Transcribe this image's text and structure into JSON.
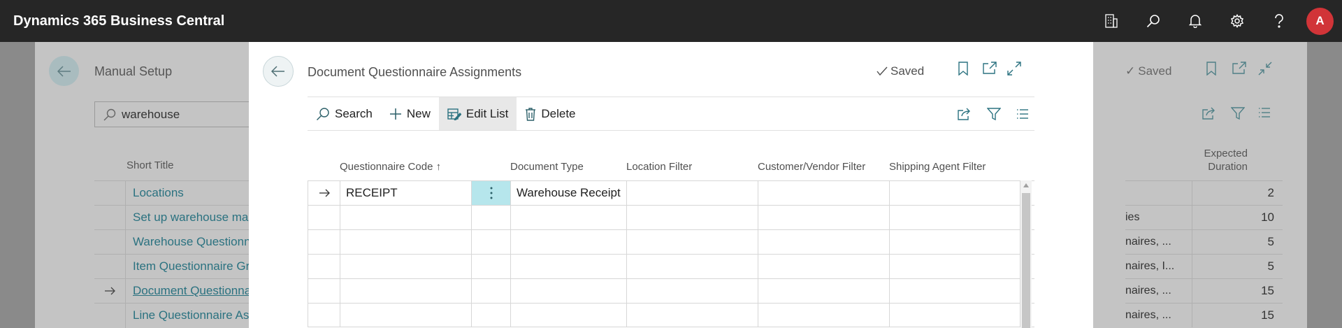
{
  "app": {
    "title": "Dynamics 365 Business Central",
    "avatar_initial": "A"
  },
  "appbar_icons": [
    "company-icon",
    "search-icon",
    "bell-icon",
    "gear-icon",
    "help-icon"
  ],
  "background": {
    "title": "Manual Setup",
    "search_value": "warehouse",
    "saved_label": "Saved",
    "column_short_title": "Short Title",
    "column_expected_line1": "Expected",
    "column_expected_line2": "Duration",
    "rows": [
      {
        "title": "Locations",
        "extra": "",
        "duration": "2"
      },
      {
        "title": "Set up warehouse man",
        "extra": "ies",
        "duration": "10"
      },
      {
        "title": "Warehouse Questionna",
        "extra": "naires, ...",
        "duration": "5"
      },
      {
        "title": "Item Questionnaire Gro",
        "extra": "naires, I...",
        "duration": "5"
      },
      {
        "title": "Document Questionna",
        "extra": "naires, ...",
        "duration": "15"
      },
      {
        "title": "Line Questionnaire Ass",
        "extra": "naires, ...",
        "duration": "15"
      }
    ]
  },
  "dialog": {
    "title": "Document Questionnaire Assignments",
    "saved_label": "Saved",
    "actions": {
      "search": "Search",
      "new": "New",
      "edit_list": "Edit List",
      "delete": "Delete"
    },
    "columns": {
      "questionnaire_code": "Questionnaire Code",
      "sort_indicator": "↑",
      "document_type": "Document Type",
      "location_filter": "Location Filter",
      "customer_vendor_filter": "Customer/Vendor Filter",
      "shipping_agent_filter": "Shipping Agent Filter"
    },
    "rows": [
      {
        "code": "RECEIPT",
        "document_type": "Warehouse Receipt",
        "location": "",
        "custvend": "",
        "shipping": ""
      },
      {
        "code": "",
        "document_type": "",
        "location": "",
        "custvend": "",
        "shipping": ""
      },
      {
        "code": "",
        "document_type": "",
        "location": "",
        "custvend": "",
        "shipping": ""
      },
      {
        "code": "",
        "document_type": "",
        "location": "",
        "custvend": "",
        "shipping": ""
      },
      {
        "code": "",
        "document_type": "",
        "location": "",
        "custvend": "",
        "shipping": ""
      },
      {
        "code": "",
        "document_type": "",
        "location": "",
        "custvend": "",
        "shipping": ""
      }
    ]
  },
  "colors": {
    "appbar": "#262626",
    "accent": "#2b7280",
    "selected_cell": "#b6e6ec",
    "avatar": "#d13438"
  }
}
